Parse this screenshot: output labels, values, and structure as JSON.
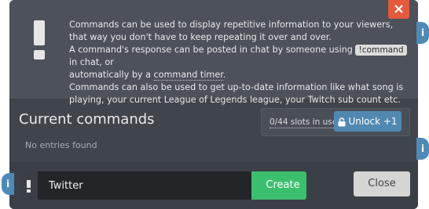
{
  "info": {
    "line1": "Commands can be used to display repetitive information to your viewers, that way you don't have to keep repeating it over and over.",
    "line2_pre": "A command's response can be posted in chat by someone using ",
    "line2_code": "!command",
    "line2_post": " in chat, or",
    "line3_pre": "automatically by a ",
    "line3_link": "command timer",
    "line3_post": ".",
    "line4": "Commands can also be used to get up-to-date information like what song is playing, your current League of Legends league, your Twitch sub count etc."
  },
  "section": {
    "title": "Current commands",
    "slots_text": "0/44 slots in use",
    "unlock_label": "Unlock +1",
    "empty_text": "No entries found"
  },
  "form": {
    "input_value": "Twitter",
    "create_label": "Create",
    "close_label": "Close"
  },
  "icons": {
    "close": "×",
    "info": "i"
  },
  "colors": {
    "accent_green": "#3bbf6e",
    "accent_blue": "#5188b0",
    "close_red": "#e35a3d"
  }
}
